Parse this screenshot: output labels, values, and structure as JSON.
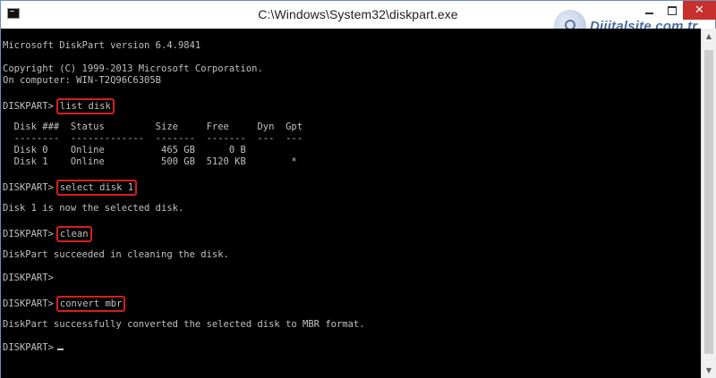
{
  "window": {
    "title": "C:\\Windows\\System32\\diskpart.exe",
    "close_glyph": "✕",
    "watermark_text": "Dijitalsite.com.tr"
  },
  "console": {
    "l01": "Microsoft DiskPart version 6.4.9841",
    "l02": "Copyright (C) 1999-2013 Microsoft Corporation.",
    "l03": "On computer: WIN-T2Q96C6305B",
    "prompt1": "DISKPART>",
    "cmd1": "list disk",
    "table_header": "  Disk ###  Status         Size     Free     Dyn  Gpt",
    "table_sep": "  --------  -------------  -------  -------  ---  ---",
    "table_row1": "  Disk 0    Online          465 GB      0 B",
    "table_row2": "  Disk 1    Online          500 GB  5120 KB        *",
    "prompt2": "DISKPART>",
    "cmd2": "select disk 1",
    "out2": "Disk 1 is now the selected disk.",
    "prompt3": "DISKPART>",
    "cmd3": "clean",
    "out3": "DiskPart succeeded in cleaning the disk.",
    "prompt4": "DISKPART>",
    "prompt5": "DISKPART>",
    "cmd5": "convert mbr",
    "out5": "DiskPart successfully converted the selected disk to MBR format.",
    "prompt6": "DISKPART>"
  },
  "colors": {
    "console_bg": "#000000",
    "console_text": "#c0c0c0",
    "highlight_border": "#d61f1f",
    "close_button": "#c7302c"
  }
}
